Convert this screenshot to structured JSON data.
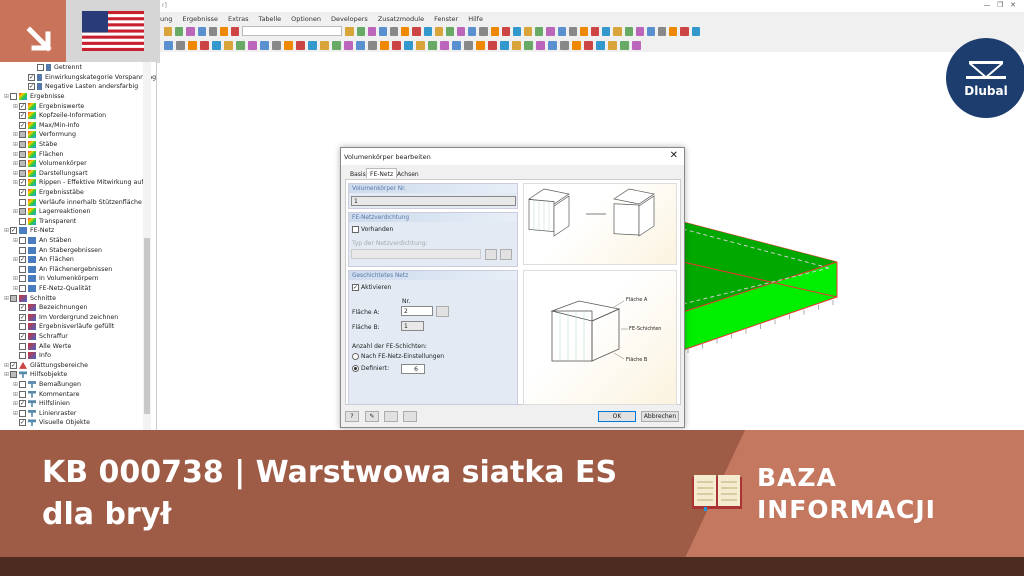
{
  "window": {
    "title_fragment": "r]"
  },
  "menu": [
    "ung",
    "Ergebnisse",
    "Extras",
    "Tabelle",
    "Optionen",
    "Developers",
    "Zusatzmodule",
    "Fenster",
    "Hilfe"
  ],
  "tree": [
    {
      "label": "Getrennt",
      "level": 3,
      "state": 0,
      "icon": "load"
    },
    {
      "label": "Einwirkungskategorie Vorspannung",
      "level": 2,
      "state": 1,
      "icon": "load"
    },
    {
      "label": "Negative Lasten andersfarbig",
      "level": 2,
      "state": 1,
      "icon": "load"
    },
    {
      "label": "Ergebnisse",
      "level": 0,
      "state": 0,
      "icon": "res",
      "exp": true
    },
    {
      "label": "Ergebniswerte",
      "level": 1,
      "state": 1,
      "icon": "res",
      "exp": true
    },
    {
      "label": "Kopfzeile-Information",
      "level": 1,
      "state": 1,
      "icon": "res"
    },
    {
      "label": "Max/Min-Info",
      "level": 1,
      "state": 1,
      "icon": "res"
    },
    {
      "label": "Verformung",
      "level": 1,
      "state": 2,
      "icon": "res",
      "exp": true
    },
    {
      "label": "Stäbe",
      "level": 1,
      "state": 2,
      "icon": "res",
      "exp": true
    },
    {
      "label": "Flächen",
      "level": 1,
      "state": 2,
      "icon": "res",
      "exp": true
    },
    {
      "label": "Volumenkörper",
      "level": 1,
      "state": 2,
      "icon": "res",
      "exp": true
    },
    {
      "label": "Darstellungsart",
      "level": 1,
      "state": 2,
      "icon": "res",
      "exp": true
    },
    {
      "label": "Rippen - Effektive Mitwirkung auf F",
      "level": 1,
      "state": 1,
      "icon": "res",
      "exp": true
    },
    {
      "label": "Ergebnisstäbe",
      "level": 1,
      "state": 1,
      "icon": "res"
    },
    {
      "label": "Verläufe innerhalb Stützenfläche",
      "level": 1,
      "state": 0,
      "icon": "res"
    },
    {
      "label": "Lagerreaktionen",
      "level": 1,
      "state": 2,
      "icon": "res",
      "exp": true
    },
    {
      "label": "Transparent",
      "level": 1,
      "state": 0,
      "icon": "res"
    },
    {
      "label": "FE-Netz",
      "level": 0,
      "state": 1,
      "icon": "mesh",
      "exp": true
    },
    {
      "label": "An Stäben",
      "level": 1,
      "state": 0,
      "icon": "mesh",
      "exp": true
    },
    {
      "label": "An Stabergebnissen",
      "level": 1,
      "state": 0,
      "icon": "mesh"
    },
    {
      "label": "An Flächen",
      "level": 1,
      "state": 1,
      "icon": "mesh",
      "exp": true
    },
    {
      "label": "An Flächenergebnissen",
      "level": 1,
      "state": 0,
      "icon": "mesh"
    },
    {
      "label": "In Volumenkörpern",
      "level": 1,
      "state": 0,
      "icon": "mesh",
      "exp": true
    },
    {
      "label": "FE-Netz-Qualität",
      "level": 1,
      "state": 0,
      "icon": "mesh",
      "exp": true
    },
    {
      "label": "Schnitte",
      "level": 0,
      "state": 2,
      "icon": "cut",
      "exp": true
    },
    {
      "label": "Bezeichnungen",
      "level": 1,
      "state": 1,
      "icon": "cut"
    },
    {
      "label": "Im Vordergrund zeichnen",
      "level": 1,
      "state": 1,
      "icon": "cut"
    },
    {
      "label": "Ergebnisverläufe gefüllt",
      "level": 1,
      "state": 0,
      "icon": "cut"
    },
    {
      "label": "Schraffur",
      "level": 1,
      "state": 1,
      "icon": "cut"
    },
    {
      "label": "Alle Werte",
      "level": 1,
      "state": 0,
      "icon": "cut"
    },
    {
      "label": "Info",
      "level": 1,
      "state": 0,
      "icon": "cut"
    },
    {
      "label": "Glättungsbereiche",
      "level": 0,
      "state": 1,
      "icon": "smooth",
      "exp": true
    },
    {
      "label": "Hilfsobjekte",
      "level": 0,
      "state": 2,
      "icon": "help",
      "exp": true
    },
    {
      "label": "Bemaßungen",
      "level": 1,
      "state": 0,
      "icon": "help",
      "exp": true
    },
    {
      "label": "Kommentare",
      "level": 1,
      "state": 0,
      "icon": "help",
      "exp": true
    },
    {
      "label": "Hilfslinien",
      "level": 1,
      "state": 1,
      "icon": "help",
      "exp": true
    },
    {
      "label": "Linienraster",
      "level": 1,
      "state": 0,
      "icon": "help",
      "exp": true
    },
    {
      "label": "Visuelle Objekte",
      "level": 1,
      "state": 1,
      "icon": "help"
    }
  ],
  "dialog": {
    "title": "Volumenkörper bearbeiten",
    "tabs": [
      "Basis",
      "FE-Netz",
      "Achsen"
    ],
    "solid_group": "Volumenkörper Nr.",
    "solid_no": "1",
    "refine_group": "FE-Netzverdichtung",
    "refine_check": "Vorhanden",
    "refine_type_label": "Typ der Netzverdichtung:",
    "layer_group": "Geschichtetes Netz",
    "activate": "Aktivieren",
    "nr_header": "Nr.",
    "face_a_label": "Fläche A:",
    "face_a": "2",
    "face_b_label": "Fläche B:",
    "face_b": "1",
    "layers_label": "Anzahl der FE-Schichten:",
    "opt_mesh": "Nach FE-Netz-Einstellungen",
    "opt_defined": "Definiert:",
    "layers_value": "6",
    "img_face_a": "Fläche A",
    "img_layers": "FE-Schichten",
    "img_face_b": "Fläche B",
    "ok": "OK",
    "cancel": "Abbrechen"
  },
  "banner": {
    "title": "KB 000738 | Warstwowa siatka ES dla brył",
    "category_line1": "BAZA",
    "category_line2": "INFORMACJI"
  },
  "logo": "Dlubal",
  "colors": {
    "banner_dark": "#9e5c46",
    "banner_light": "#c47860",
    "logo": "#1c3d6e",
    "model_green": "#00ee00"
  }
}
